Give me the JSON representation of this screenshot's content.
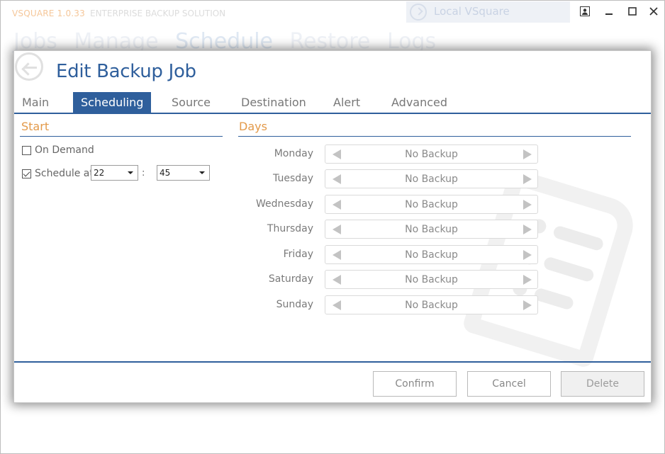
{
  "app": {
    "brand": "VSQUARE 1.0.33",
    "subtitle": "ENTERPRISE BACKUP SOLUTION",
    "server": "Local VSquare",
    "nav": [
      "Jobs",
      "Manage",
      "Schedule",
      "Restore",
      "Logs"
    ]
  },
  "dialog": {
    "title": "Edit Backup Job",
    "tabs": [
      "Main",
      "Scheduling",
      "Source",
      "Destination",
      "Alert",
      "Advanced"
    ],
    "active_tab": "Scheduling",
    "start": {
      "heading": "Start",
      "on_demand_label": "On Demand",
      "on_demand_checked": false,
      "schedule_at_label": "Schedule at",
      "schedule_at_checked": true,
      "hour": "22",
      "minute": "45",
      "separator": ":"
    },
    "days": {
      "heading": "Days",
      "items": [
        {
          "day": "Monday",
          "value": "No Backup"
        },
        {
          "day": "Tuesday",
          "value": "No Backup"
        },
        {
          "day": "Wednesday",
          "value": "No Backup"
        },
        {
          "day": "Thursday",
          "value": "No Backup"
        },
        {
          "day": "Friday",
          "value": "No Backup"
        },
        {
          "day": "Saturday",
          "value": "No Backup"
        },
        {
          "day": "Sunday",
          "value": "No Backup"
        }
      ]
    },
    "buttons": {
      "confirm": "Confirm",
      "cancel": "Cancel",
      "delete": "Delete"
    }
  },
  "colors": {
    "accent": "#2f5f9c",
    "section_heading": "#e39a4a"
  }
}
